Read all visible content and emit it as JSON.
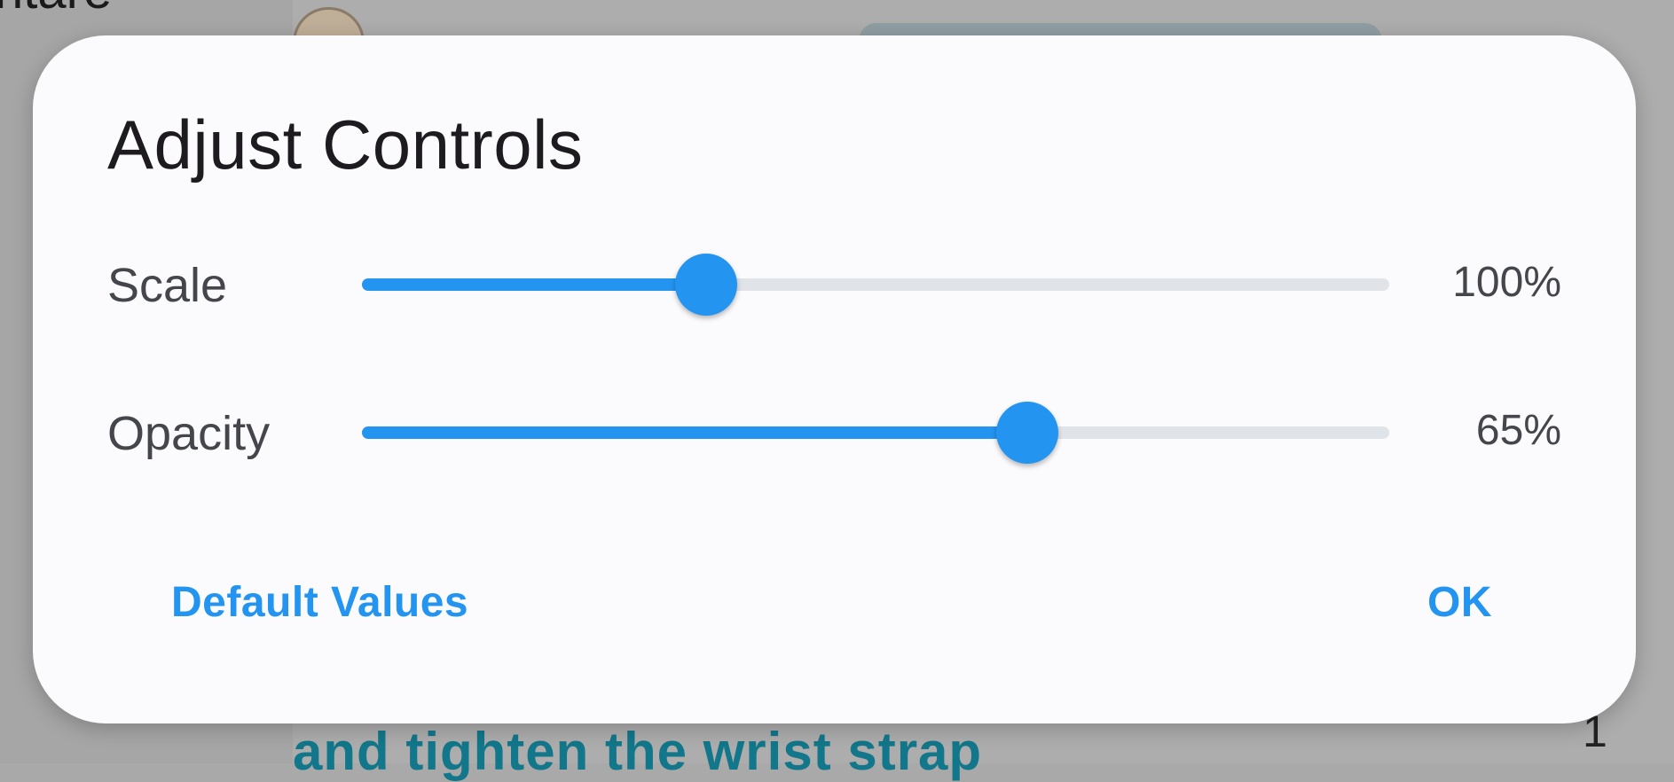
{
  "background": {
    "partial_title": "ntare",
    "instruction_text": "and tighten the wrist strap",
    "page_number": "1"
  },
  "dialog": {
    "title": "Adjust Controls",
    "sliders": [
      {
        "label": "Scale",
        "value_text": "100%",
        "level": 0.335
      },
      {
        "label": "Opacity",
        "value_text": "65%",
        "level": 0.648
      }
    ],
    "buttons": {
      "default_label": "Default Values",
      "ok_label": "OK"
    }
  },
  "colors": {
    "accent": "#2394f0",
    "track": "#e0e3e8",
    "dialog_background": "#fbfbfd",
    "scrim": "#a9a9a9"
  }
}
